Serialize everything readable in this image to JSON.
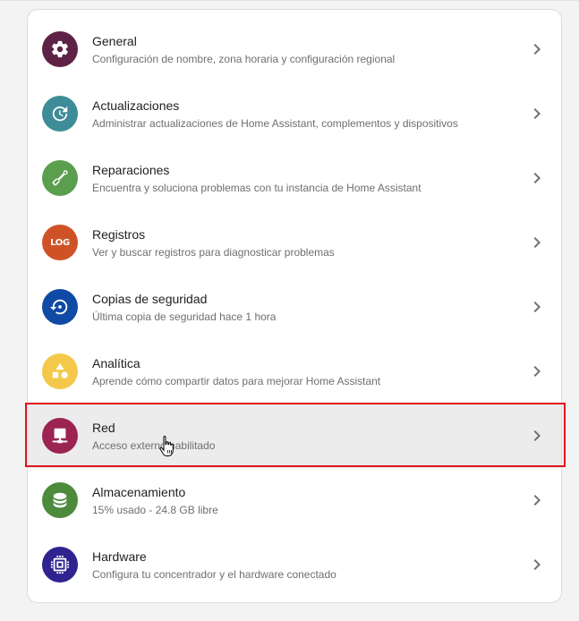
{
  "settings": {
    "items": [
      {
        "id": "general",
        "title": "General",
        "description": "Configuración de nombre, zona horaria y configuración regional",
        "icon": "gear-icon",
        "color": "#5e2246"
      },
      {
        "id": "updates",
        "title": "Actualizaciones",
        "description": "Administrar actualizaciones de Home Assistant, complementos y dispositivos",
        "icon": "update-clock-icon",
        "color": "#3d8c98"
      },
      {
        "id": "repairs",
        "title": "Reparaciones",
        "description": "Encuentra y soluciona problemas con tu instancia de Home Assistant",
        "icon": "wrench-icon",
        "color": "#5a9e4e"
      },
      {
        "id": "logs",
        "title": "Registros",
        "description": "Ver y buscar registros para diagnosticar problemas",
        "icon": "log-icon",
        "icon_text": "LOG",
        "color": "#cf5227"
      },
      {
        "id": "backups",
        "title": "Copias de seguridad",
        "description": "Última copia de seguridad hace 1 hora",
        "icon": "backup-restore-icon",
        "color": "#0f4ba5"
      },
      {
        "id": "analytics",
        "title": "Analítica",
        "description": "Aprende cómo compartir datos para mejorar Home Assistant",
        "icon": "shapes-icon",
        "color": "#f4c84a"
      },
      {
        "id": "network",
        "title": "Red",
        "description": "Acceso externo habilitado",
        "icon": "network-icon",
        "color": "#9b2453"
      },
      {
        "id": "storage",
        "title": "Almacenamiento",
        "description": "15% usado - 24.8 GB libre",
        "icon": "database-icon",
        "color": "#4c8a3c"
      },
      {
        "id": "hardware",
        "title": "Hardware",
        "description": "Configura tu concentrador y el hardware conectado",
        "icon": "chip-icon",
        "color": "#2f2390"
      }
    ]
  }
}
